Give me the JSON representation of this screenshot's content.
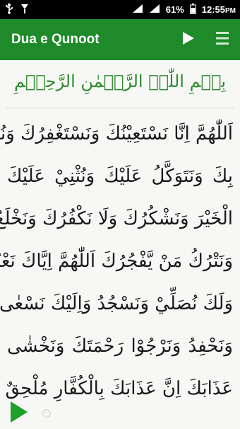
{
  "status_bar": {
    "battery": "61%",
    "time": "12:55",
    "time_suffix": "PM",
    "icons": [
      "usb-icon",
      "download-icon",
      "signal-icon",
      "battery-icon"
    ]
  },
  "app_bar": {
    "title": "Dua e Qunoot",
    "actions": [
      "play-icon",
      "menu-icon"
    ],
    "color": "#1e8a2a"
  },
  "content": {
    "bismillah": "بِسۡمِ اللّٰہِ الرَّحۡمٰنِ الرَّحِیۡمِ",
    "bismillah_color": "#2d8a2d",
    "lines": [
      "اَللّٰهُمَّ اِنَّا نَسْتَعِيْنُكَ وَنَسْتَغْفِرُكَ وَنُؤْمِنُ",
      "بِكَ وَنَتَوَكَّلُ عَلَيْكَ وَنُثْنِيْ عَلَيْكَ",
      "الْخَيْرَ وَنَشْكُرُكَ وَلَا نَكْفُرُكَ وَنَخْلَعُ",
      "وَنَتْرُكُ مَنْ يَّفْجُرُكَ اَللّٰهُمَّ اِيَّاكَ نَعْبُدُ",
      "وَلَكَ نُصَلِّيْ وَنَسْجُدُ وَاِلَيْكَ نَسْعٰى",
      "وَنَحْفِدُ وَنَرْجُوْا رَحْمَتَكَ وَنَخْشٰى",
      "عَذَابَكَ اِنَّ عَذَابَكَ بِالْكُفَّارِ مُلْحِقٌ"
    ]
  },
  "player": {
    "play_icon": "play-icon",
    "progress": 0,
    "accent": "#1fa02a"
  }
}
